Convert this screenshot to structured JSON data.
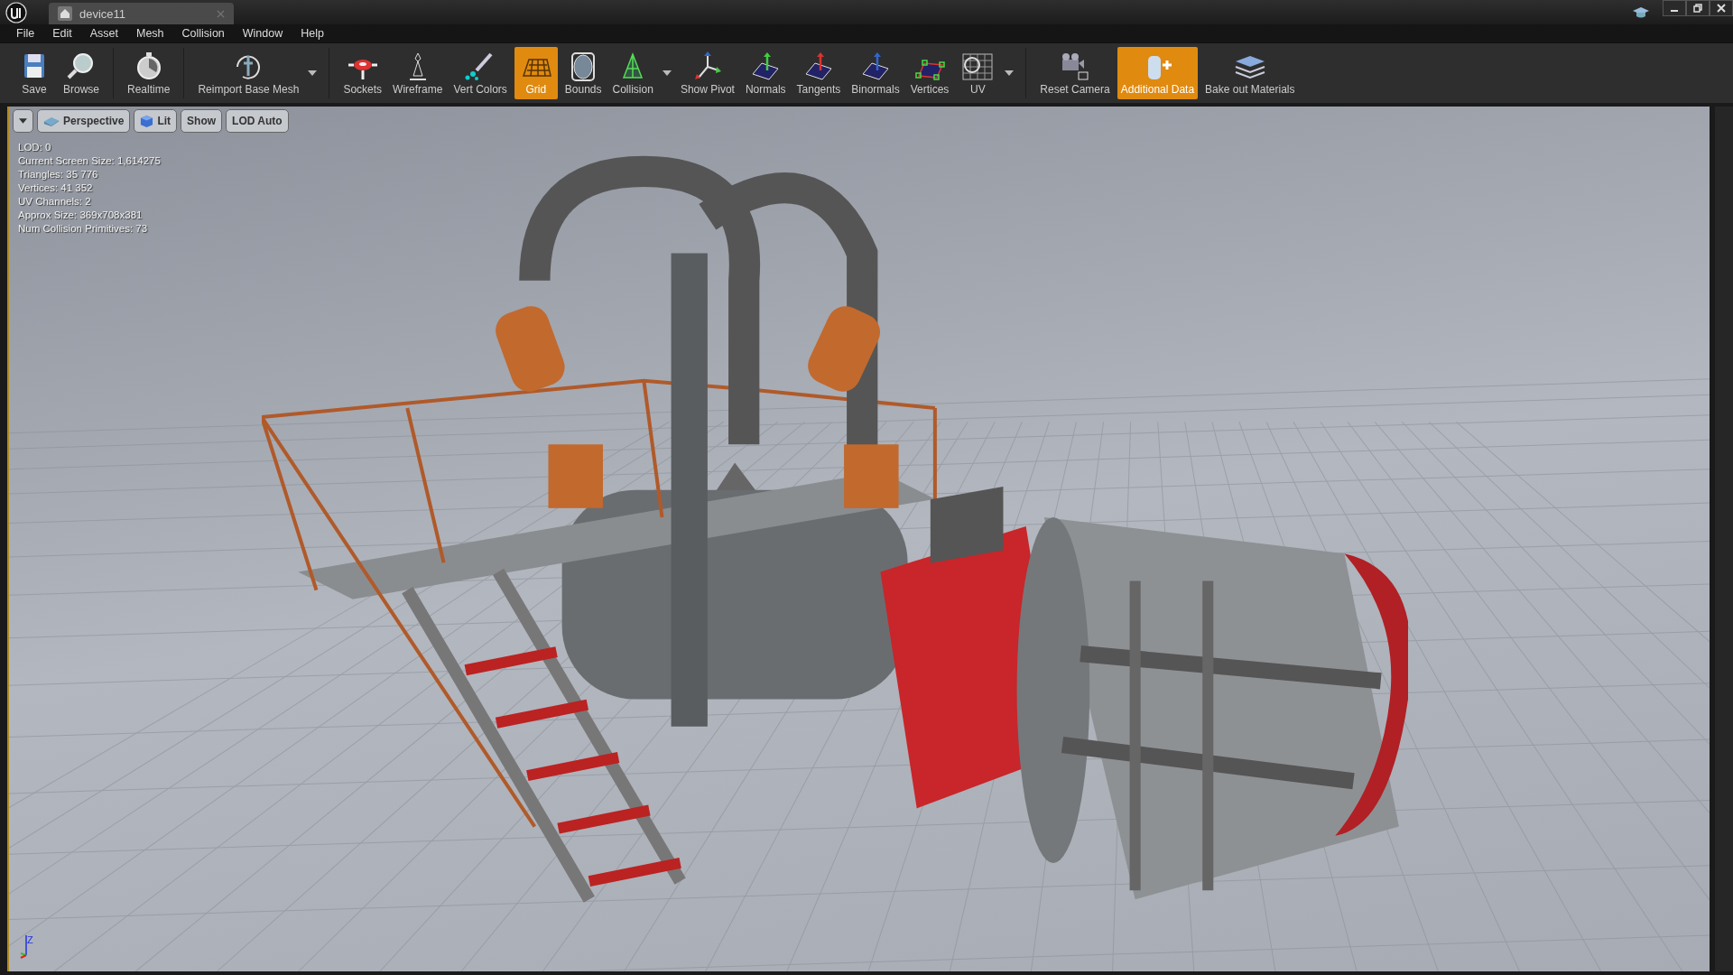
{
  "window": {
    "tab_title": "device11"
  },
  "menu": [
    "File",
    "Edit",
    "Asset",
    "Mesh",
    "Collision",
    "Window",
    "Help"
  ],
  "toolbar": {
    "groups": [
      {
        "buttons": [
          {
            "label": "Save",
            "selected": false,
            "dropdown": false
          },
          {
            "label": "Browse",
            "selected": false,
            "dropdown": false
          }
        ]
      },
      {
        "buttons": [
          {
            "label": "Realtime",
            "selected": false,
            "dropdown": false
          }
        ]
      },
      {
        "buttons": [
          {
            "label": "Reimport Base Mesh",
            "selected": false,
            "dropdown": true
          }
        ]
      },
      {
        "buttons": [
          {
            "label": "Sockets",
            "selected": false,
            "dropdown": false
          },
          {
            "label": "Wireframe",
            "selected": false,
            "dropdown": false
          },
          {
            "label": "Vert Colors",
            "selected": false,
            "dropdown": false
          },
          {
            "label": "Grid",
            "selected": true,
            "dropdown": false
          },
          {
            "label": "Bounds",
            "selected": false,
            "dropdown": false
          },
          {
            "label": "Collision",
            "selected": false,
            "dropdown": true
          },
          {
            "label": "Show Pivot",
            "selected": false,
            "dropdown": false
          },
          {
            "label": "Normals",
            "selected": false,
            "dropdown": false
          },
          {
            "label": "Tangents",
            "selected": false,
            "dropdown": false
          },
          {
            "label": "Binormals",
            "selected": false,
            "dropdown": false
          },
          {
            "label": "Vertices",
            "selected": false,
            "dropdown": false
          },
          {
            "label": "UV",
            "selected": false,
            "dropdown": true
          }
        ]
      },
      {
        "buttons": [
          {
            "label": "Reset Camera",
            "selected": false,
            "dropdown": false
          },
          {
            "label": "Additional Data",
            "selected": true,
            "dropdown": false
          },
          {
            "label": "Bake out Materials",
            "selected": false,
            "dropdown": false
          }
        ]
      }
    ]
  },
  "viewport": {
    "buttons": [
      {
        "label": "Perspective",
        "kind": "view"
      },
      {
        "label": "Lit",
        "kind": "lit"
      },
      {
        "label": "Show",
        "kind": "plain"
      },
      {
        "label": "LOD Auto",
        "kind": "plain"
      }
    ],
    "stats": [
      "LOD:  0",
      "Current Screen Size:  1,614275",
      "Triangles:  35 776",
      "Vertices:  41 352",
      "UV Channels:  2",
      "Approx Size: 369x708x381",
      "Num Collision Primitives:  73"
    ],
    "axis_label": "Z"
  }
}
